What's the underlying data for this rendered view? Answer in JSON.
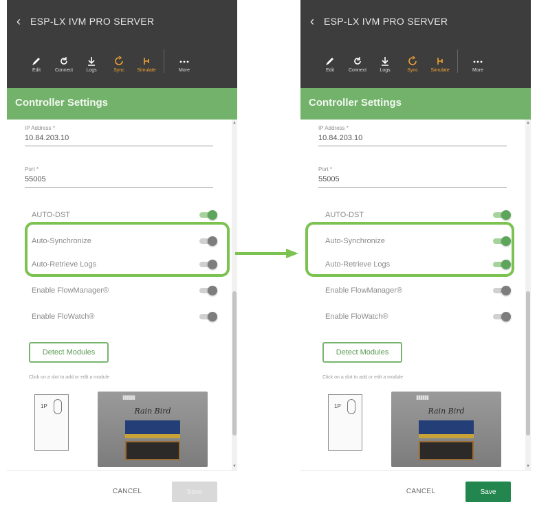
{
  "screens": [
    {
      "title": "ESP-LX IVM PRO SERVER",
      "toolbar": [
        "Edit",
        "Connect",
        "Logs",
        "Sync",
        "Simulate",
        "More"
      ],
      "header": "Controller Settings",
      "fields": [
        {
          "label": "IP Address *",
          "value": "10.84.203.10"
        },
        {
          "label": "Port *",
          "value": "55005"
        }
      ],
      "toggles": [
        {
          "label": "AUTO-DST",
          "state": "on"
        },
        {
          "label": "Auto-Synchronize",
          "state": "off"
        },
        {
          "label": "Auto-Retrieve Logs",
          "state": "off"
        },
        {
          "label": "Enable FlowManager®",
          "state": "off"
        },
        {
          "label": "Enable FloWatch®",
          "state": "off"
        }
      ],
      "detect_label": "Detect Modules",
      "note": "Click on a slot to add or edit a module",
      "module_number": "1P",
      "device_pins": "IIIIIIIIIIII",
      "device_brand": "Rain Bird",
      "cancel_label": "CANCEL",
      "save_label": "Save",
      "save_state": "disabled"
    },
    {
      "title": "ESP-LX IVM PRO SERVER",
      "toolbar": [
        "Edit",
        "Connect",
        "Logs",
        "Sync",
        "Simulate",
        "More"
      ],
      "header": "Controller Settings",
      "fields": [
        {
          "label": "IP Address *",
          "value": "10.84.203.10"
        },
        {
          "label": "Port *",
          "value": "55005"
        }
      ],
      "toggles": [
        {
          "label": "AUTO-DST",
          "state": "on"
        },
        {
          "label": "Auto-Synchronize",
          "state": "on"
        },
        {
          "label": "Auto-Retrieve Logs",
          "state": "on"
        },
        {
          "label": "Enable FlowManager®",
          "state": "off"
        },
        {
          "label": "Enable FloWatch®",
          "state": "off"
        }
      ],
      "detect_label": "Detect Modules",
      "note": "Click on a slot to add or edit a module",
      "module_number": "1P",
      "device_pins": "IIIIIIIIIIII",
      "device_brand": "Rain Bird",
      "cancel_label": "CANCEL",
      "save_label": "Save",
      "save_state": "enabled"
    }
  ],
  "colors": {
    "appbar": "#3d3d3d",
    "header": "#72b26a",
    "highlight": "#7bc251",
    "toggle_on": "#5da55a",
    "save_enabled": "#24864f"
  },
  "icons": {
    "back": "chevron-left-icon",
    "edit": "pencil-icon",
    "connect": "refresh-icon",
    "logs": "download-icon",
    "sync": "sync-icon",
    "simulate": "simulate-icon",
    "more": "more-icon"
  }
}
